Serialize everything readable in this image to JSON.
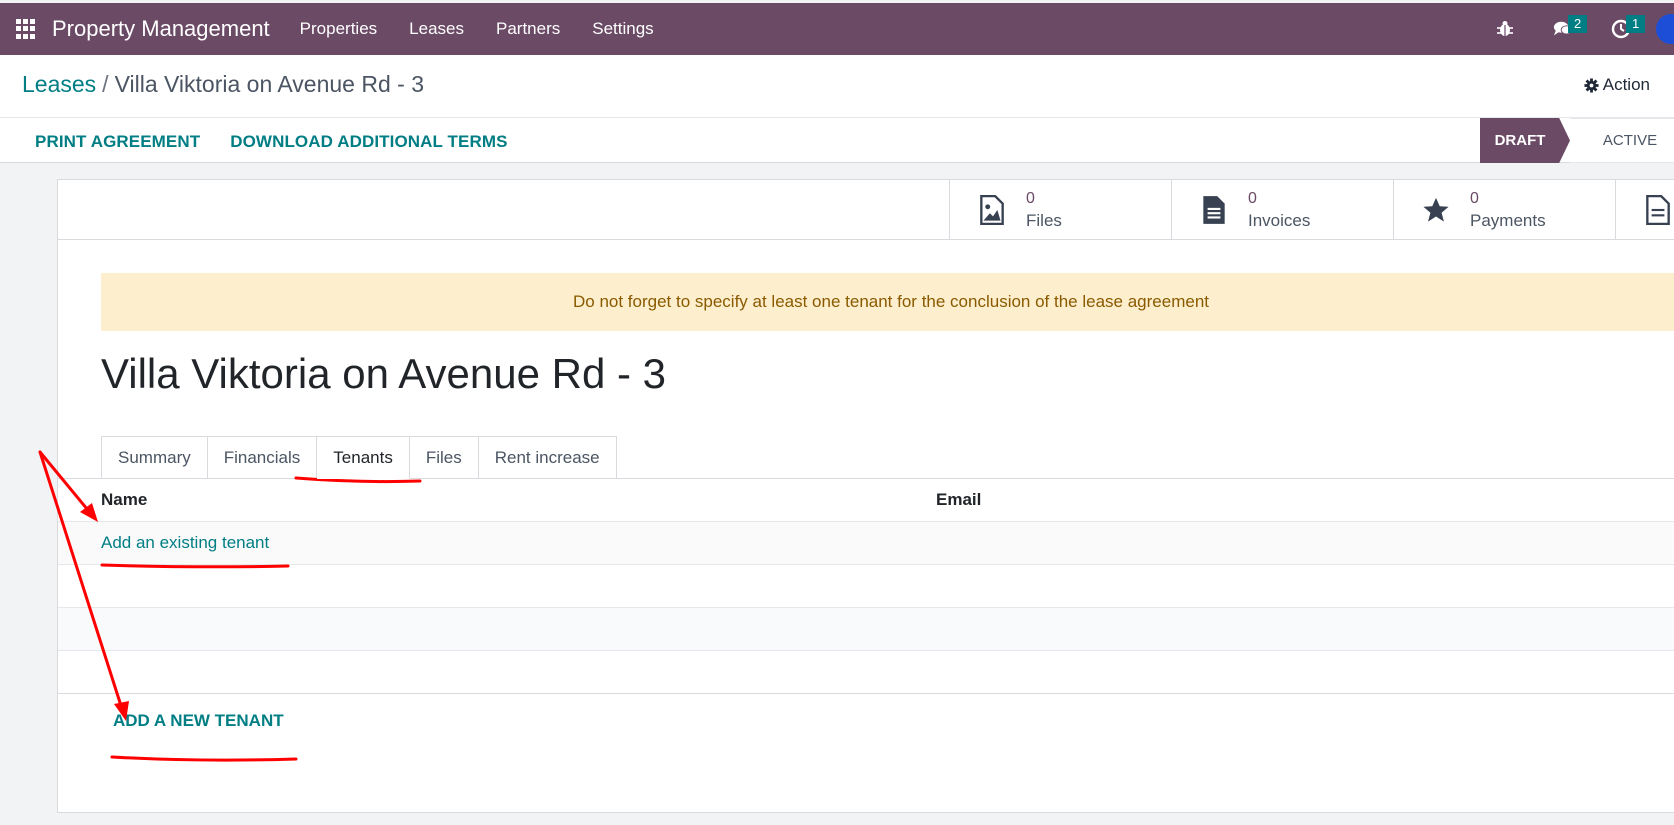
{
  "navbar": {
    "app_title": "Property Management",
    "menu": [
      "Properties",
      "Leases",
      "Partners",
      "Settings"
    ],
    "messages_count": "2",
    "activities_count": "1"
  },
  "breadcrumb": {
    "parent": "Leases",
    "separator": "/",
    "current": "Villa Viktoria on Avenue Rd - 3"
  },
  "action_label": "Action",
  "header_buttons": {
    "print": "PRINT AGREEMENT",
    "download": "DOWNLOAD ADDITIONAL TERMS"
  },
  "statusbar": {
    "draft": "DRAFT",
    "active": "ACTIVE"
  },
  "smart_buttons": [
    {
      "value": "0",
      "label": "Files",
      "icon": "image-file-icon"
    },
    {
      "value": "0",
      "label": "Invoices",
      "icon": "document-icon"
    },
    {
      "value": "0",
      "label": "Payments",
      "icon": "star-icon"
    }
  ],
  "alert": "Do not forget to specify at least one tenant for the conclusion of the lease agreement",
  "record_title": "Villa Viktoria on Avenue Rd - 3",
  "tabs": [
    "Summary",
    "Financials",
    "Tenants",
    "Files",
    "Rent increase"
  ],
  "active_tab": "Tenants",
  "table": {
    "columns": [
      "Name",
      "Email"
    ],
    "add_existing": "Add an existing tenant"
  },
  "add_new_tenant": "ADD A NEW TENANT",
  "colors": {
    "navbar": "#6b4a66",
    "link": "#017e84",
    "alert_bg": "#fdefcd",
    "annotation": "#ff0000"
  }
}
